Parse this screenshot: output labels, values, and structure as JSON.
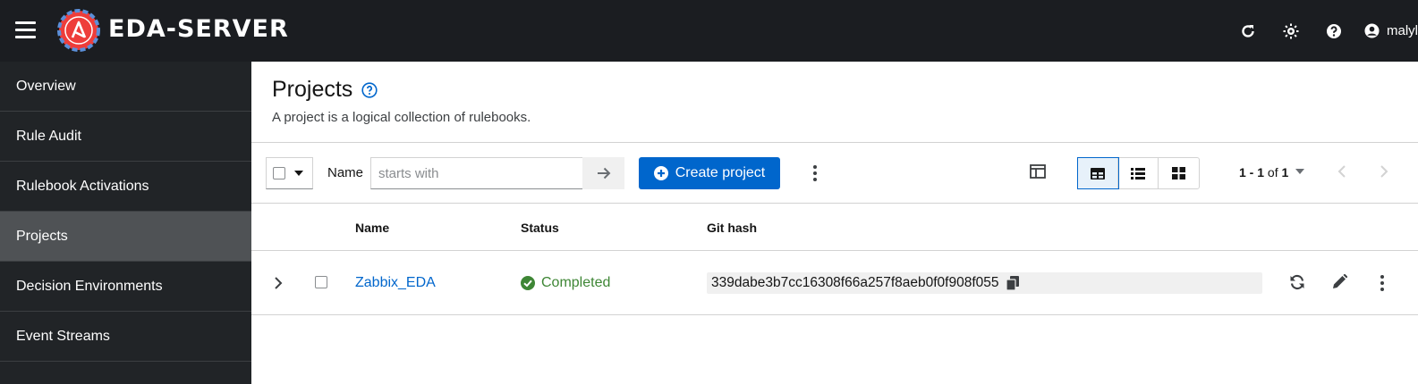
{
  "app": {
    "brand": "EDA-SERVER",
    "username": "malyl"
  },
  "colors": {
    "header_bg": "#1b1d21",
    "sidebar_bg": "#212427",
    "sidebar_active": "#4f5255",
    "primary": "#0066cc",
    "success": "#3e8635",
    "logo_red": "#ee3d3a"
  },
  "sidebar": {
    "items": [
      {
        "label": "Overview",
        "active": false
      },
      {
        "label": "Rule Audit",
        "active": false
      },
      {
        "label": "Rulebook Activations",
        "active": false
      },
      {
        "label": "Projects",
        "active": true
      },
      {
        "label": "Decision Environments",
        "active": false
      },
      {
        "label": "Event Streams",
        "active": false
      }
    ]
  },
  "page": {
    "title": "Projects",
    "description": "A project is a logical collection of rulebooks."
  },
  "toolbar": {
    "filter_label": "Name",
    "filter_placeholder": "starts with",
    "create_label": "Create project",
    "pagination_range": "1 - 1",
    "pagination_of": "of",
    "pagination_total": "1"
  },
  "table": {
    "columns": [
      "Name",
      "Status",
      "Git hash"
    ],
    "rows": [
      {
        "name": "Zabbix_EDA",
        "status": "Completed",
        "git_hash": "339dabe3b7cc16308f66a257f8aeb0f0f908f055"
      }
    ]
  }
}
